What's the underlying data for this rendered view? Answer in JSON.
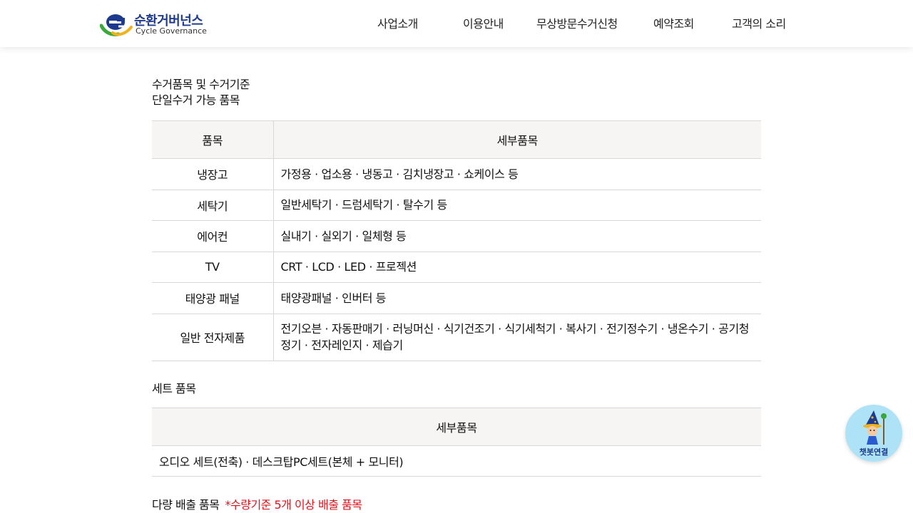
{
  "header": {
    "logo_ko": "순환거버넌스",
    "logo_en": "Cycle Governance",
    "colors": {
      "logo_blue": "#1d3a8f",
      "logo_green": "#3aa83a",
      "logo_yellow": "#f2b21b"
    },
    "nav": [
      {
        "label": "사업소개"
      },
      {
        "label": "이용안내"
      },
      {
        "label": "무상방문수거신청"
      },
      {
        "label": "예약조회"
      },
      {
        "label": "고객의 소리"
      }
    ]
  },
  "main": {
    "title_line1": "수거품목 및 수거기준",
    "title_line2": "단일수거 가능 품목",
    "table1": {
      "headers": [
        "품목",
        "세부품목"
      ],
      "rows": [
        {
          "item": "냉장고",
          "detail": "가정용 · 업소용 · 냉동고 · 김치냉장고 · 쇼케이스 등"
        },
        {
          "item": "세탁기",
          "detail": "일반세탁기 · 드럼세탁기 · 탈수기 등"
        },
        {
          "item": "에어컨",
          "detail": "실내기 · 실외기 · 일체형 등"
        },
        {
          "item": "TV",
          "detail": "CRT · LCD · LED · 프로젝션"
        },
        {
          "item": "태양광 패널",
          "detail": "태양광패널 · 인버터 등"
        },
        {
          "item": "일반 전자제품",
          "detail": "전기오븐 ·  자동판매기 ·  러닝머신 ·  식기건조기 ·  식기세척기 ·  복사기 ·  전기정수기 ·  냉온수기 ·  공기청정기 ·  전자레인지 ·  제습기"
        }
      ]
    },
    "section2_title": "세트 품목",
    "table2": {
      "header": "세부품목",
      "row": "오디오 세트(전축) ·  데스크탑PC세트(본체 + 모니터)"
    },
    "section3_title": "다량 배출 품목",
    "section3_note": "*수량기준 5개 이상 배출 품목",
    "note_color": "#e0121b"
  },
  "chatbot": {
    "label": "챗봇연결",
    "icon": "wizard-mascot-icon"
  }
}
